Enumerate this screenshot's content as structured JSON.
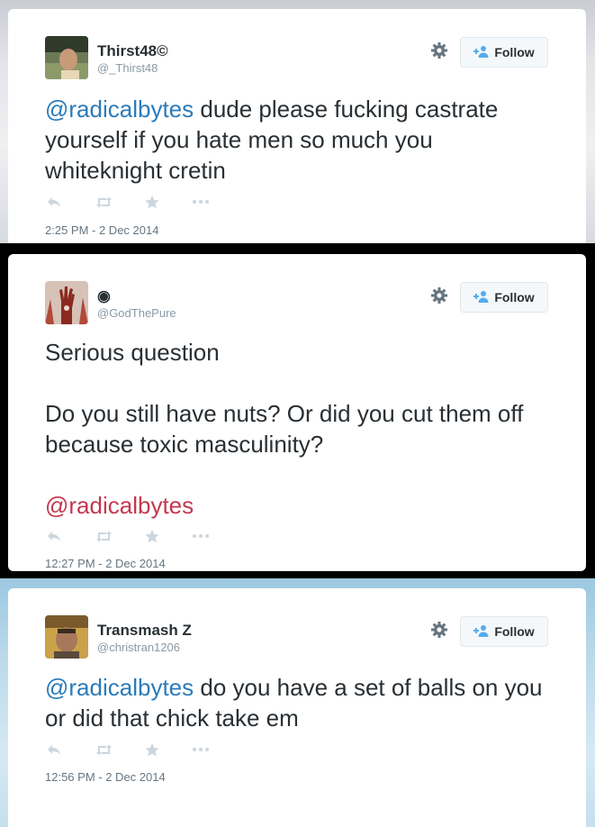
{
  "tweets": [
    {
      "name": "Thirst48©",
      "handle": "@_Thirst48",
      "mention": "@radicalbytes",
      "text": " dude please fucking castrate yourself if you hate men so much you whiteknight cretin",
      "timestamp": "2:25 PM - 2 Dec 2014",
      "follow_label": "Follow"
    },
    {
      "name": "◉",
      "handle": "@GodThePure",
      "text_line1": "Serious question",
      "text_line2": "Do you still have nuts? Or did you cut them off because toxic masculinity?",
      "mention": "@radicalbytes",
      "timestamp": "12:27 PM - 2 Dec 2014",
      "follow_label": "Follow"
    },
    {
      "name": "Transmash Z",
      "handle": "@christran1206",
      "mention": "@radicalbytes",
      "text": " do you have a set of balls on you or did that chick take em",
      "timestamp": "12:56 PM - 2 Dec 2014",
      "follow_label": "Follow"
    }
  ],
  "colors": {
    "link": "#2b7bb9",
    "link_red": "#c4384f",
    "muted": "#8899a6"
  }
}
